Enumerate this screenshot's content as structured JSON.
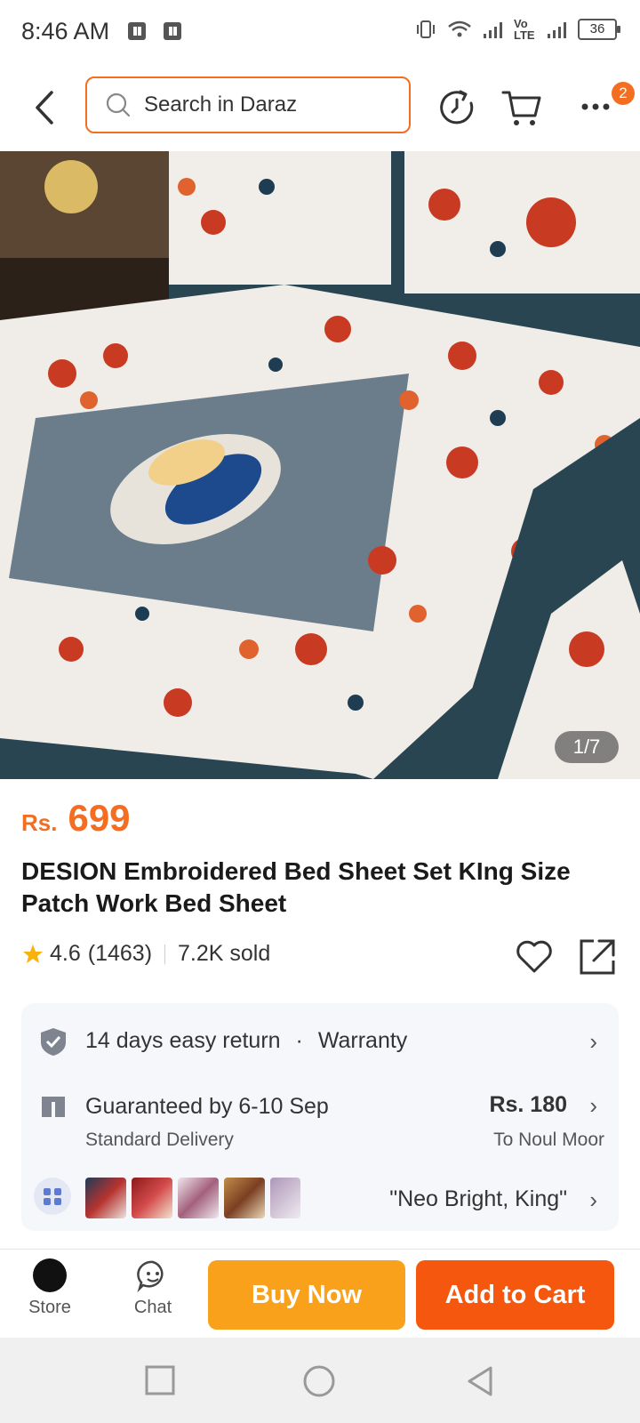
{
  "status_bar": {
    "time": "8:46 AM",
    "network_label": "Vo LTE",
    "battery": "36"
  },
  "header": {
    "search_placeholder": "Search in Daraz",
    "badge_count": "2"
  },
  "gallery": {
    "counter": "1/7"
  },
  "product": {
    "currency": "Rs.",
    "price": "699",
    "title": "DESION Embroidered Bed Sheet Set KIng Size Patch Work Bed Sheet",
    "rating": "4.6",
    "reviews": "(1463)",
    "sold": "7.2K sold"
  },
  "info": {
    "return_text": "14 days easy return",
    "dot": "·",
    "warranty_text": "Warranty",
    "delivery_text": "Guaranteed by 6-10 Sep",
    "delivery_sub": "Standard Delivery",
    "delivery_price": "Rs. 180",
    "delivery_to": "To Noul Moor",
    "variant_text": "\"Neo Bright, King\""
  },
  "bottom": {
    "store": "Store",
    "chat": "Chat",
    "buy_now": "Buy Now",
    "add_to_cart": "Add to Cart"
  },
  "colors": {
    "accent": "#f36e21",
    "buy": "#f9a11b",
    "cart": "#f5570e"
  }
}
